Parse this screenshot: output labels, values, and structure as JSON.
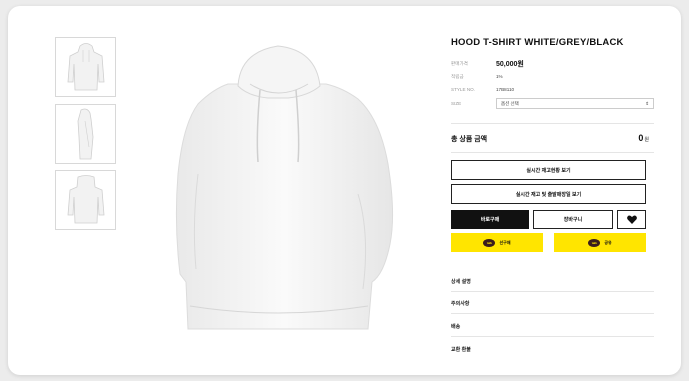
{
  "product": {
    "title": "HOOD T-SHIRT WHITE/GREY/BLACK",
    "specs": [
      {
        "label": "판매가격",
        "value": "50,000원"
      },
      {
        "label": "적립금",
        "value": "1%"
      },
      {
        "label": "STYLE NO.",
        "value": "17B8110"
      },
      {
        "label": "SIZE",
        "value": "옵션 선택"
      }
    ],
    "size_select_arrow": "⇕"
  },
  "total": {
    "label": "총 상품 금액",
    "value": "0",
    "unit": "원"
  },
  "buttons": {
    "stock": "실시간 재고현황 보기",
    "store_stock": "실시간 재고 및 출발매장일 보기",
    "buy": "바로구매",
    "cart": "장바구니",
    "kakao_gift_badge": "talk",
    "kakao_gift": "선구매",
    "kakao_share_badge": "talk",
    "kakao_share": "공유"
  },
  "accordion": [
    "상세 설명",
    "주의사항",
    "배송",
    "교환 환불"
  ],
  "colors": {
    "accent_yellow": "#ffe500",
    "primary_black": "#111111"
  }
}
